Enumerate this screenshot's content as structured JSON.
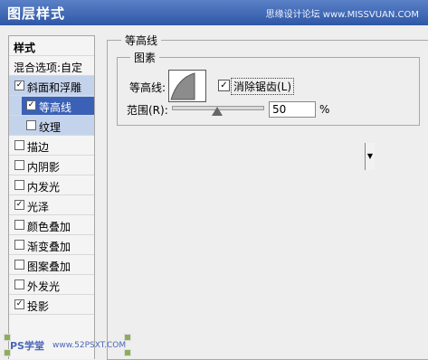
{
  "window": {
    "title": "图层样式",
    "watermark": "思缘设计论坛 www.MISSVUAN.COM"
  },
  "sidebar": {
    "items": [
      {
        "label": "样式",
        "checkbox": false,
        "checked": false,
        "state": "header"
      },
      {
        "label": "混合选项:自定",
        "checkbox": false,
        "checked": false,
        "state": "normal"
      },
      {
        "label": "斜面和浮雕",
        "checkbox": true,
        "checked": true,
        "state": "selected-parent"
      },
      {
        "label": "等高线",
        "checkbox": true,
        "checked": true,
        "state": "selected",
        "indent": true
      },
      {
        "label": "纹理",
        "checkbox": true,
        "checked": false,
        "state": "sub",
        "indent": true
      },
      {
        "label": "描边",
        "checkbox": true,
        "checked": false,
        "state": "normal"
      },
      {
        "label": "内阴影",
        "checkbox": true,
        "checked": false,
        "state": "normal"
      },
      {
        "label": "内发光",
        "checkbox": true,
        "checked": false,
        "state": "normal"
      },
      {
        "label": "光泽",
        "checkbox": true,
        "checked": true,
        "state": "normal"
      },
      {
        "label": "颜色叠加",
        "checkbox": true,
        "checked": false,
        "state": "normal"
      },
      {
        "label": "渐变叠加",
        "checkbox": true,
        "checked": false,
        "state": "normal"
      },
      {
        "label": "图案叠加",
        "checkbox": true,
        "checked": false,
        "state": "normal"
      },
      {
        "label": "外发光",
        "checkbox": true,
        "checked": false,
        "state": "normal"
      },
      {
        "label": "投影",
        "checkbox": true,
        "checked": true,
        "state": "normal"
      }
    ]
  },
  "panel": {
    "group_title": "等高线",
    "section_title": "图素",
    "contour_label": "等高线:",
    "anti_alias_label": "消除锯齿(L)",
    "anti_alias_checked": true,
    "range_label": "范围(R):",
    "range_value": "50",
    "range_fraction": 0.5,
    "range_unit": "%"
  },
  "footer": {
    "badge": "PS学堂",
    "url": "www.52PSXT.COM"
  },
  "colors": {
    "titlebar": "#2e57a6",
    "selected": "#3a61b6",
    "selected_light": "#c4d3ec"
  }
}
